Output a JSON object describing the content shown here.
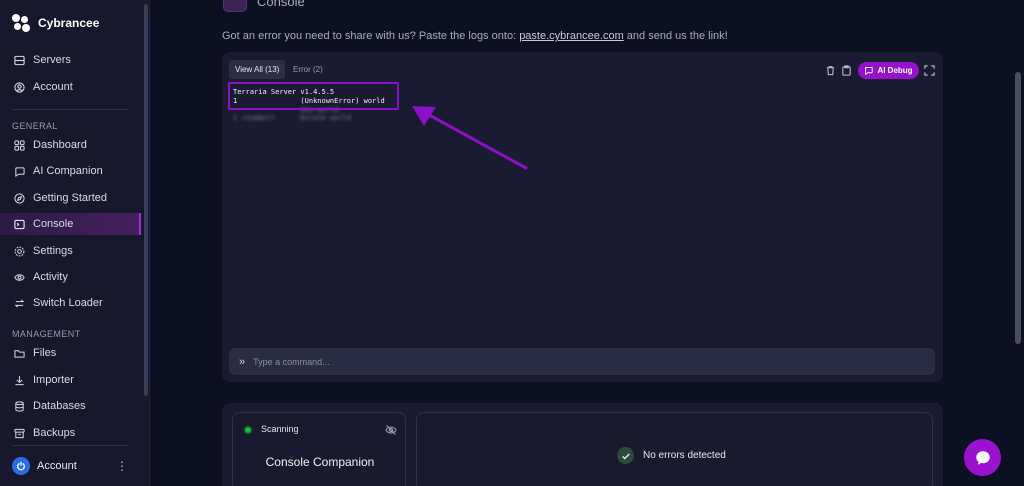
{
  "app": {
    "name": "Cybrancee"
  },
  "sidebar": {
    "top_items": [
      {
        "label": "Servers",
        "icon": "server-icon"
      },
      {
        "label": "Account",
        "icon": "user-circle-icon"
      }
    ],
    "general_title": "GENERAL",
    "general_items": [
      {
        "label": "Dashboard",
        "icon": "grid-icon"
      },
      {
        "label": "AI Companion",
        "icon": "chat-icon"
      },
      {
        "label": "Getting Started",
        "icon": "compass-icon"
      },
      {
        "label": "Console",
        "icon": "terminal-icon",
        "active": true
      },
      {
        "label": "Settings",
        "icon": "gear-icon"
      },
      {
        "label": "Activity",
        "icon": "eye-icon"
      },
      {
        "label": "Switch Loader",
        "icon": "swap-icon"
      }
    ],
    "management_title": "MANAGEMENT",
    "management_items": [
      {
        "label": "Files",
        "icon": "folder-icon"
      },
      {
        "label": "Importer",
        "icon": "download-icon"
      },
      {
        "label": "Databases",
        "icon": "database-icon"
      },
      {
        "label": "Backups",
        "icon": "archive-icon"
      }
    ],
    "account_label": "Account"
  },
  "header": {
    "title": "Console"
  },
  "notice": {
    "before": "Got an error you need to share with us? Paste the logs onto: ",
    "link": "paste.cybrancee.com",
    "after": " and send us the link!"
  },
  "console": {
    "tabs": [
      {
        "label": "View All (13)",
        "active": true
      },
      {
        "label": "Error (2)",
        "active": false
      }
    ],
    "ai_debug_label": "AI Debug",
    "lines": [
      "Terraria Server v1.4.5.5",
      "1               (UnknownError) world",
      "                New world",
      "2 <number>      Delete world"
    ],
    "command_placeholder": "Type a command..."
  },
  "companion": {
    "status": "Scanning",
    "title": "Console Companion",
    "result": "No errors detected"
  },
  "colors": {
    "accent": "#9512c9",
    "background": "#0d0f22",
    "panel": "#1a1b33",
    "scan_green": "#1fb447"
  }
}
